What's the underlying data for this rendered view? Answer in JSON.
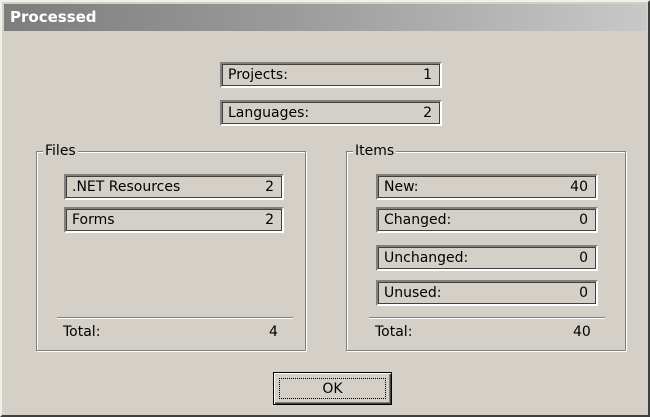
{
  "window": {
    "title": "Processed"
  },
  "summary": [
    {
      "label": "Projects:",
      "value": "1"
    },
    {
      "label": "Languages:",
      "value": "2"
    }
  ],
  "files": {
    "title": "Files",
    "items": [
      {
        "label": ".NET Resources",
        "value": "2"
      },
      {
        "label": "Forms",
        "value": "2"
      }
    ],
    "total_label": "Total:",
    "total_value": "4"
  },
  "items": {
    "title": "Items",
    "items": [
      {
        "label": "New:",
        "value": "40"
      },
      {
        "label": "Changed:",
        "value": "0"
      },
      {
        "label": "Unchanged:",
        "value": "0"
      },
      {
        "label": "Unused:",
        "value": "0"
      }
    ],
    "total_label": "Total:",
    "total_value": "40"
  },
  "buttons": {
    "ok_label": "OK"
  }
}
